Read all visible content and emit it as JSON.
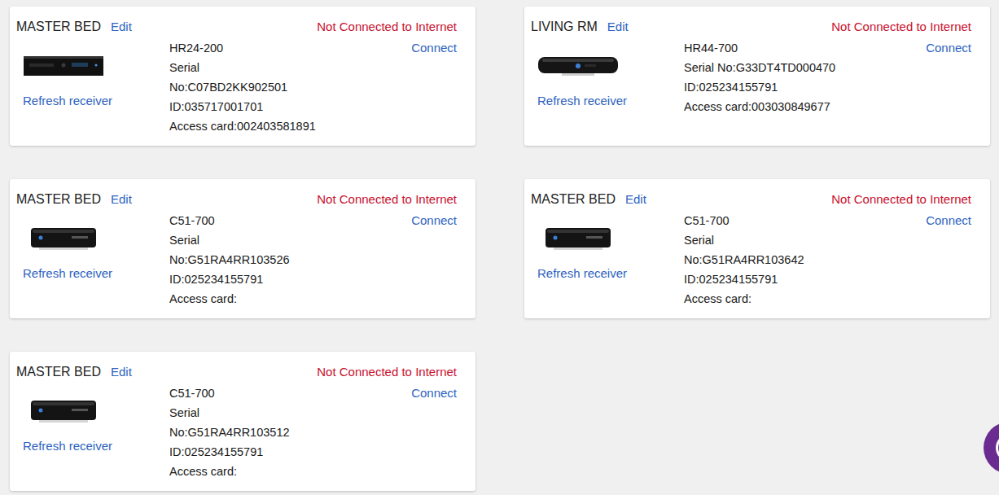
{
  "receivers": [
    {
      "name": "MASTER BED",
      "edit": "Edit",
      "status": "Not Connected to Internet",
      "connect": "Connect",
      "refresh": "Refresh receiver",
      "kind": "dvr-wide",
      "lines": [
        "HR24-200",
        "Serial",
        "No:C07BD2KK902501",
        "ID:035717001701",
        "Access card:002403581891"
      ]
    },
    {
      "name": "LIVING RM",
      "edit": "Edit",
      "status": "Not Connected to Internet",
      "connect": "Connect",
      "refresh": "Refresh receiver",
      "kind": "dvr-rounded",
      "lines": [
        "HR44-700",
        "Serial No:G33DT4TD000470",
        "ID:025234155791",
        "Access card:003030849677"
      ]
    },
    {
      "name": "MASTER BED",
      "edit": "Edit",
      "status": "Not Connected to Internet",
      "connect": "Connect",
      "refresh": "Refresh receiver",
      "kind": "client",
      "lines": [
        "C51-700",
        "Serial",
        "No:G51RA4RR103526",
        "ID:025234155791",
        "Access card:"
      ]
    },
    {
      "name": "MASTER BED",
      "edit": "Edit",
      "status": "Not Connected to Internet",
      "connect": "Connect",
      "refresh": "Refresh receiver",
      "kind": "client",
      "lines": [
        "C51-700",
        "Serial",
        "No:G51RA4RR103642",
        "ID:025234155791",
        "Access card:"
      ]
    },
    {
      "name": "MASTER BED",
      "edit": "Edit",
      "status": "Not Connected to Internet",
      "connect": "Connect",
      "refresh": "Refresh receiver",
      "kind": "client",
      "lines": [
        "C51-700",
        "Serial",
        "No:G51RA4RR103512",
        "ID:025234155791",
        "Access card:"
      ]
    }
  ]
}
